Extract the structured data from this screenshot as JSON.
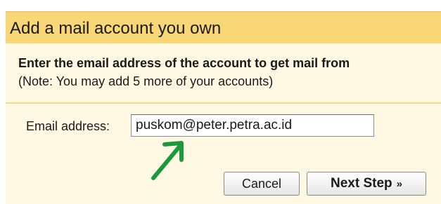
{
  "dialog": {
    "title": "Add a mail account you own",
    "instruction": "Enter the email address of the account to get mail from",
    "note": "(Note: You may add 5 more of your accounts)"
  },
  "form": {
    "email_label": "Email address:",
    "email_value": "puskom@peter.petra.ac.id"
  },
  "buttons": {
    "cancel_label": "Cancel",
    "next_label": "Next Step",
    "next_icon": "»"
  },
  "annotation": {
    "arrow_icon": "pointer-arrow-icon",
    "arrow_color": "#1a9a3a"
  },
  "colors": {
    "header_bg": "#f9d776",
    "panel_bg": "#fff8e2"
  }
}
